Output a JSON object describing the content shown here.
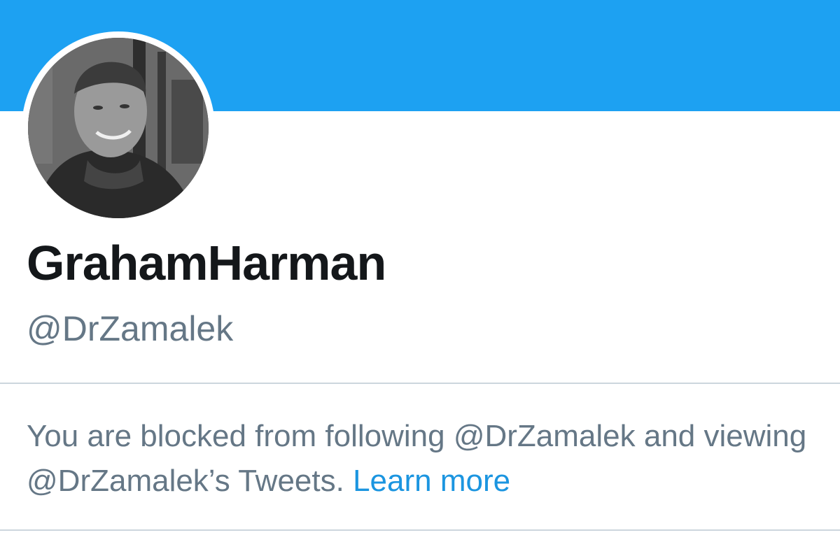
{
  "profile": {
    "display_name": "GrahamHarman",
    "handle": "@DrZamalek"
  },
  "block_notice": {
    "message": "You are blocked from following @DrZamalek and viewing @DrZamalek’s Tweets.",
    "link_label": "Learn more"
  },
  "colors": {
    "banner": "#1DA1F2",
    "name_text": "#14171A",
    "secondary_text": "#657786",
    "link": "#1B95E0",
    "divider": "#CCD6DD"
  }
}
